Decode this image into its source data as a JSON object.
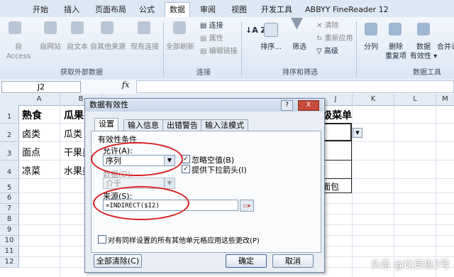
{
  "ribbon_tabs": [
    "开始",
    "插入",
    "页面布局",
    "公式",
    "数据",
    "审阅",
    "视图",
    "开发工具",
    "ABBYY FineReader 12"
  ],
  "ribbon": {
    "get_external": [
      "自 Access",
      "自网站",
      "自文本",
      "自其他来源",
      "现有连接"
    ],
    "connections": {
      "refresh_all": "全部刷新",
      "items": [
        "连接",
        "属性",
        "编辑链接"
      ]
    },
    "sort_filter": {
      "sort": "排序...",
      "filter": "筛选",
      "items": [
        "清除",
        "重新应用",
        "高级"
      ]
    },
    "tools": [
      "分列",
      "删除\n重复项",
      "数据\n有效性 ▾",
      "合并计"
    ],
    "groups": {
      "external": "获取外部数据",
      "connections": "连接",
      "sort_filter": "排序和筛选",
      "tools": "数据工具"
    }
  },
  "formula_bar": {
    "name_box": "J2",
    "fx": "fx"
  },
  "columns": [
    "A",
    "B",
    "",
    "",
    "",
    "",
    "",
    "",
    "J",
    "K",
    "L",
    "M"
  ],
  "rows": [
    "1",
    "2",
    "3",
    "4",
    "5",
    "6",
    "7",
    "8",
    "9",
    "10",
    "11",
    "12"
  ],
  "cells": {
    "A1": "熟食",
    "B1": "瓜果",
    "A2": "卤类",
    "B2": "瓜类",
    "A3": "面点",
    "B3": "干果类",
    "A4": "凉菜",
    "B4": "水果类",
    "J1": "级菜单",
    "J5": "面包"
  },
  "dialog": {
    "title": "数据有效性",
    "help": "?",
    "close": "X",
    "tabs": [
      "设置",
      "输入信息",
      "出错警告",
      "输入法模式"
    ],
    "section": "有效性条件",
    "allow_label": "允许(A):",
    "allow_value": "序列",
    "ignore_blank": "忽略空值(B)",
    "dropdown": "提供下拉箭头(I)",
    "data_label": "数据(D):",
    "data_value": "介于",
    "source_label": "来源(S):",
    "source_value": "=INDIRECT($I2)",
    "apply_all": "对有同样设置的所有其他单元格应用这些更改(P)",
    "clear_all": "全部清除(C)",
    "ok": "确定",
    "cancel": "取消"
  },
  "watermark": "头条 @比目鱼2号"
}
